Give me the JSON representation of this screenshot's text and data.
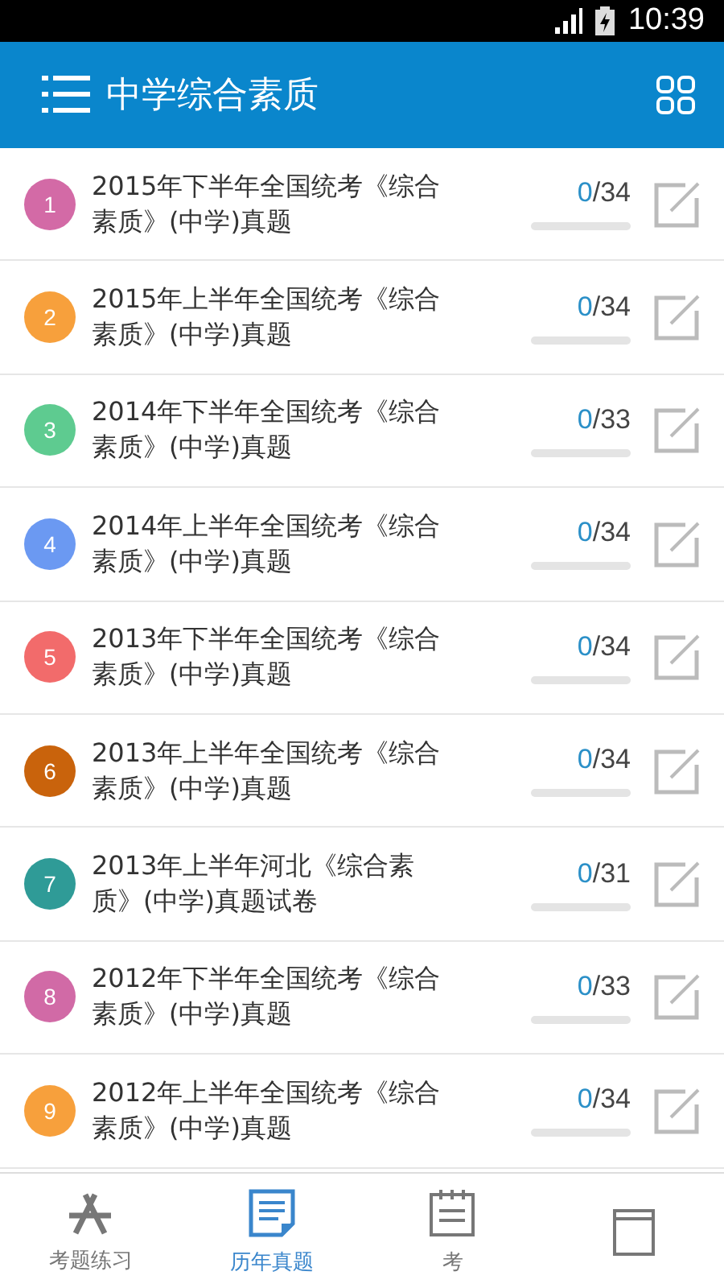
{
  "status_bar": {
    "time": "10:39"
  },
  "header": {
    "title": "中学综合素质"
  },
  "papers": [
    {
      "number": "1",
      "color": "#d36aa6",
      "title": "2015年下半年全国统考《综合素质》(中学)真题",
      "done": "0",
      "total": "/34"
    },
    {
      "number": "2",
      "color": "#f7a03c",
      "title": "2015年上半年全国统考《综合素质》(中学)真题",
      "done": "0",
      "total": "/34"
    },
    {
      "number": "3",
      "color": "#5ecb90",
      "title": "2014年下半年全国统考《综合素质》(中学)真题",
      "done": "0",
      "total": "/33"
    },
    {
      "number": "4",
      "color": "#6b99f2",
      "title": "2014年上半年全国统考《综合素质》(中学)真题",
      "done": "0",
      "total": "/34"
    },
    {
      "number": "5",
      "color": "#f26b6b",
      "title": "2013年下半年全国统考《综合素质》(中学)真题",
      "done": "0",
      "total": "/34"
    },
    {
      "number": "6",
      "color": "#c9630c",
      "title": "2013年上半年全国统考《综合素质》(中学)真题",
      "done": "0",
      "total": "/34"
    },
    {
      "number": "7",
      "color": "#2f9b97",
      "title": "2013年上半年河北《综合素质》(中学)真题试卷",
      "done": "0",
      "total": "/31"
    },
    {
      "number": "8",
      "color": "#d16aa6",
      "title": "2012年下半年全国统考《综合素质》(中学)真题",
      "done": "0",
      "total": "/33"
    },
    {
      "number": "9",
      "color": "#f7a03c",
      "title": "2012年上半年全国统考《综合素质》(中学)真题",
      "done": "0",
      "total": "/34"
    }
  ],
  "tabs": [
    {
      "kind": "practice",
      "label": "考题练习",
      "selected": false
    },
    {
      "kind": "papers",
      "label": "历年真题",
      "selected": true
    },
    {
      "kind": "calendar",
      "label": "考",
      "selected": false
    },
    {
      "kind": "book",
      "selected": false
    }
  ]
}
